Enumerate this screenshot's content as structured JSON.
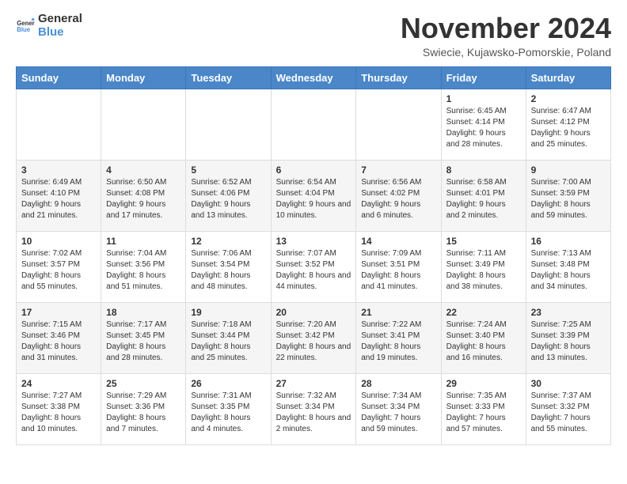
{
  "logo": {
    "general": "General",
    "blue": "Blue"
  },
  "title": "November 2024",
  "location": "Swiecie, Kujawsko-Pomorskie, Poland",
  "days_of_week": [
    "Sunday",
    "Monday",
    "Tuesday",
    "Wednesday",
    "Thursday",
    "Friday",
    "Saturday"
  ],
  "weeks": [
    [
      {
        "day": "",
        "info": ""
      },
      {
        "day": "",
        "info": ""
      },
      {
        "day": "",
        "info": ""
      },
      {
        "day": "",
        "info": ""
      },
      {
        "day": "",
        "info": ""
      },
      {
        "day": "1",
        "info": "Sunrise: 6:45 AM\nSunset: 4:14 PM\nDaylight: 9 hours and 28 minutes."
      },
      {
        "day": "2",
        "info": "Sunrise: 6:47 AM\nSunset: 4:12 PM\nDaylight: 9 hours and 25 minutes."
      }
    ],
    [
      {
        "day": "3",
        "info": "Sunrise: 6:49 AM\nSunset: 4:10 PM\nDaylight: 9 hours and 21 minutes."
      },
      {
        "day": "4",
        "info": "Sunrise: 6:50 AM\nSunset: 4:08 PM\nDaylight: 9 hours and 17 minutes."
      },
      {
        "day": "5",
        "info": "Sunrise: 6:52 AM\nSunset: 4:06 PM\nDaylight: 9 hours and 13 minutes."
      },
      {
        "day": "6",
        "info": "Sunrise: 6:54 AM\nSunset: 4:04 PM\nDaylight: 9 hours and 10 minutes."
      },
      {
        "day": "7",
        "info": "Sunrise: 6:56 AM\nSunset: 4:02 PM\nDaylight: 9 hours and 6 minutes."
      },
      {
        "day": "8",
        "info": "Sunrise: 6:58 AM\nSunset: 4:01 PM\nDaylight: 9 hours and 2 minutes."
      },
      {
        "day": "9",
        "info": "Sunrise: 7:00 AM\nSunset: 3:59 PM\nDaylight: 8 hours and 59 minutes."
      }
    ],
    [
      {
        "day": "10",
        "info": "Sunrise: 7:02 AM\nSunset: 3:57 PM\nDaylight: 8 hours and 55 minutes."
      },
      {
        "day": "11",
        "info": "Sunrise: 7:04 AM\nSunset: 3:56 PM\nDaylight: 8 hours and 51 minutes."
      },
      {
        "day": "12",
        "info": "Sunrise: 7:06 AM\nSunset: 3:54 PM\nDaylight: 8 hours and 48 minutes."
      },
      {
        "day": "13",
        "info": "Sunrise: 7:07 AM\nSunset: 3:52 PM\nDaylight: 8 hours and 44 minutes."
      },
      {
        "day": "14",
        "info": "Sunrise: 7:09 AM\nSunset: 3:51 PM\nDaylight: 8 hours and 41 minutes."
      },
      {
        "day": "15",
        "info": "Sunrise: 7:11 AM\nSunset: 3:49 PM\nDaylight: 8 hours and 38 minutes."
      },
      {
        "day": "16",
        "info": "Sunrise: 7:13 AM\nSunset: 3:48 PM\nDaylight: 8 hours and 34 minutes."
      }
    ],
    [
      {
        "day": "17",
        "info": "Sunrise: 7:15 AM\nSunset: 3:46 PM\nDaylight: 8 hours and 31 minutes."
      },
      {
        "day": "18",
        "info": "Sunrise: 7:17 AM\nSunset: 3:45 PM\nDaylight: 8 hours and 28 minutes."
      },
      {
        "day": "19",
        "info": "Sunrise: 7:18 AM\nSunset: 3:44 PM\nDaylight: 8 hours and 25 minutes."
      },
      {
        "day": "20",
        "info": "Sunrise: 7:20 AM\nSunset: 3:42 PM\nDaylight: 8 hours and 22 minutes."
      },
      {
        "day": "21",
        "info": "Sunrise: 7:22 AM\nSunset: 3:41 PM\nDaylight: 8 hours and 19 minutes."
      },
      {
        "day": "22",
        "info": "Sunrise: 7:24 AM\nSunset: 3:40 PM\nDaylight: 8 hours and 16 minutes."
      },
      {
        "day": "23",
        "info": "Sunrise: 7:25 AM\nSunset: 3:39 PM\nDaylight: 8 hours and 13 minutes."
      }
    ],
    [
      {
        "day": "24",
        "info": "Sunrise: 7:27 AM\nSunset: 3:38 PM\nDaylight: 8 hours and 10 minutes."
      },
      {
        "day": "25",
        "info": "Sunrise: 7:29 AM\nSunset: 3:36 PM\nDaylight: 8 hours and 7 minutes."
      },
      {
        "day": "26",
        "info": "Sunrise: 7:31 AM\nSunset: 3:35 PM\nDaylight: 8 hours and 4 minutes."
      },
      {
        "day": "27",
        "info": "Sunrise: 7:32 AM\nSunset: 3:34 PM\nDaylight: 8 hours and 2 minutes."
      },
      {
        "day": "28",
        "info": "Sunrise: 7:34 AM\nSunset: 3:34 PM\nDaylight: 7 hours and 59 minutes."
      },
      {
        "day": "29",
        "info": "Sunrise: 7:35 AM\nSunset: 3:33 PM\nDaylight: 7 hours and 57 minutes."
      },
      {
        "day": "30",
        "info": "Sunrise: 7:37 AM\nSunset: 3:32 PM\nDaylight: 7 hours and 55 minutes."
      }
    ]
  ]
}
